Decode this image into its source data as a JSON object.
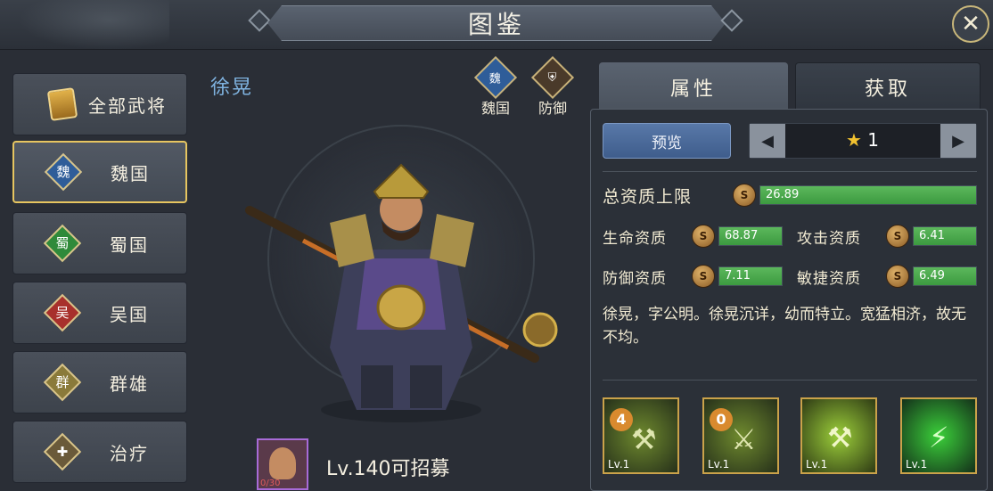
{
  "header": {
    "title": "图鉴",
    "close_icon": "close-icon"
  },
  "sidebar": {
    "items": [
      {
        "label": "全部武将",
        "icon": "general-icon"
      },
      {
        "label": "魏国",
        "icon_text": "魏",
        "color": "#2f5d99"
      },
      {
        "label": "蜀国",
        "icon_text": "蜀",
        "color": "#2f8a3a"
      },
      {
        "label": "吴国",
        "icon_text": "吴",
        "color": "#a8302c"
      },
      {
        "label": "群雄",
        "icon_text": "群",
        "color": "#8a7a3a"
      },
      {
        "label": "治疗",
        "icon": "heal-icon"
      }
    ],
    "active_index": 1
  },
  "hero": {
    "name": "徐晃",
    "faction_badge": {
      "icon_text": "魏",
      "label": "魏国"
    },
    "role_badge": {
      "label": "防御"
    },
    "recruit": {
      "progress": "0/30",
      "text": "Lv.140可招募"
    }
  },
  "tabs": [
    {
      "label": "属性",
      "active": true
    },
    {
      "label": "获取",
      "active": false
    }
  ],
  "attributes": {
    "preview_label": "预览",
    "star_value": "1",
    "total": {
      "label": "总资质上限",
      "value": "26.89",
      "fill": 1.0
    },
    "stats": [
      {
        "label": "生命资质",
        "value": "68.87",
        "fill": 1.0
      },
      {
        "label": "攻击资质",
        "value": "6.41",
        "fill": 1.0
      },
      {
        "label": "防御资质",
        "value": "7.11",
        "fill": 1.0
      },
      {
        "label": "敏捷资质",
        "value": "6.49",
        "fill": 1.0
      }
    ],
    "description": "徐晃，字公明。徐晃沉详，幼而特立。宽猛相济，故无不均。"
  },
  "skills": [
    {
      "num": "4",
      "level": "Lv.1",
      "icon": "axe-skill-icon"
    },
    {
      "num": "0",
      "level": "Lv.1",
      "icon": "axe-strike-skill-icon"
    },
    {
      "level": "Lv.1",
      "icon": "axe-whirl-skill-icon"
    },
    {
      "level": "Lv.1",
      "icon": "axe-storm-skill-icon"
    }
  ]
}
